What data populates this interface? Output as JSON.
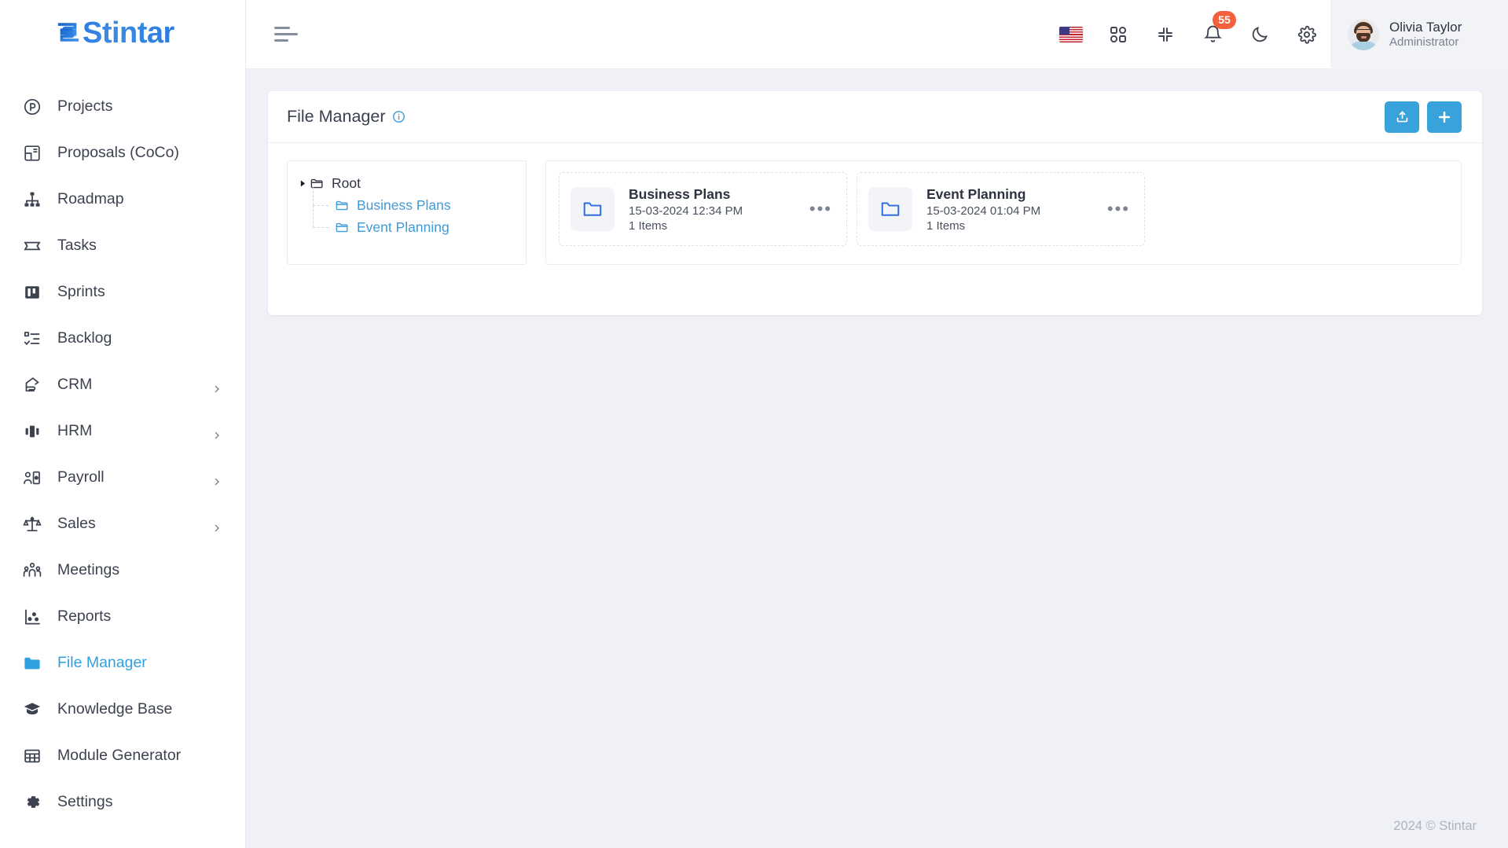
{
  "brand": {
    "name": "Stintar",
    "accent": "#2b7ddb"
  },
  "theme": {
    "page_bg": "#f0f1f6",
    "accent_blue": "#38a3db",
    "link_blue": "#3f9ad8",
    "badge_red": "#f4603e"
  },
  "sidebar": {
    "items": [
      {
        "label": "Projects",
        "icon": "circle-p-icon",
        "active": false,
        "has_submenu": false
      },
      {
        "label": "Proposals (CoCo)",
        "icon": "layout-panels-icon",
        "active": false,
        "has_submenu": false
      },
      {
        "label": "Roadmap",
        "icon": "org-chart-icon",
        "active": false,
        "has_submenu": false
      },
      {
        "label": "Tasks",
        "icon": "ticket-icon",
        "active": false,
        "has_submenu": false
      },
      {
        "label": "Sprints",
        "icon": "board-columns-icon",
        "active": false,
        "has_submenu": false
      },
      {
        "label": "Backlog",
        "icon": "checklist-icon",
        "active": false,
        "has_submenu": false
      },
      {
        "label": "CRM",
        "icon": "hand-pointer-icon",
        "active": false,
        "has_submenu": true
      },
      {
        "label": "HRM",
        "icon": "carousel-icon",
        "active": false,
        "has_submenu": true
      },
      {
        "label": "Payroll",
        "icon": "user-card-icon",
        "active": false,
        "has_submenu": true
      },
      {
        "label": "Sales",
        "icon": "scales-icon",
        "active": false,
        "has_submenu": true
      },
      {
        "label": "Meetings",
        "icon": "users-group-icon",
        "active": false,
        "has_submenu": false
      },
      {
        "label": "Reports",
        "icon": "scatter-chart-icon",
        "active": false,
        "has_submenu": false
      },
      {
        "label": "File Manager",
        "icon": "folder-filled-icon",
        "active": true,
        "has_submenu": false
      },
      {
        "label": "Knowledge Base",
        "icon": "graduation-cap-icon",
        "active": false,
        "has_submenu": false
      },
      {
        "label": "Module Generator",
        "icon": "table-grid-icon",
        "active": false,
        "has_submenu": false
      },
      {
        "label": "Settings",
        "icon": "gear-icon",
        "active": false,
        "has_submenu": false
      }
    ]
  },
  "topbar": {
    "menu_toggle": "hamburger-icon",
    "language_flag": "us-flag-icon",
    "apps_icon": "apps-grid-icon",
    "compress_icon": "compress-icon",
    "notifications_icon": "bell-icon",
    "notifications_count": "55",
    "dark_mode_icon": "moon-icon",
    "settings_icon": "gear-icon",
    "profile": {
      "name": "Olivia Taylor",
      "role": "Administrator",
      "avatar": "user-avatar"
    }
  },
  "page": {
    "title": "File Manager",
    "info_tooltip_icon": "info-circle-icon",
    "actions": [
      {
        "name": "upload",
        "icon": "upload-tray-icon"
      },
      {
        "name": "add",
        "icon": "plus-icon"
      }
    ]
  },
  "tree": {
    "root": {
      "label": "Root",
      "icon": "folder-open-icon",
      "caret": "caret-right-icon",
      "expanded": true
    },
    "children": [
      {
        "label": "Business Plans",
        "icon": "folder-open-icon"
      },
      {
        "label": "Event Planning",
        "icon": "folder-open-icon"
      }
    ]
  },
  "folders": [
    {
      "name": "Business Plans",
      "date": "15-03-2024 12:34 PM",
      "items": "1 Items",
      "icon": "folder-outline-icon",
      "menu_icon": "ellipsis-icon"
    },
    {
      "name": "Event Planning",
      "date": "15-03-2024 01:04 PM",
      "items": "1 Items",
      "icon": "folder-outline-icon",
      "menu_icon": "ellipsis-icon"
    }
  ],
  "footer": {
    "copyright": "2024 © Stintar"
  }
}
